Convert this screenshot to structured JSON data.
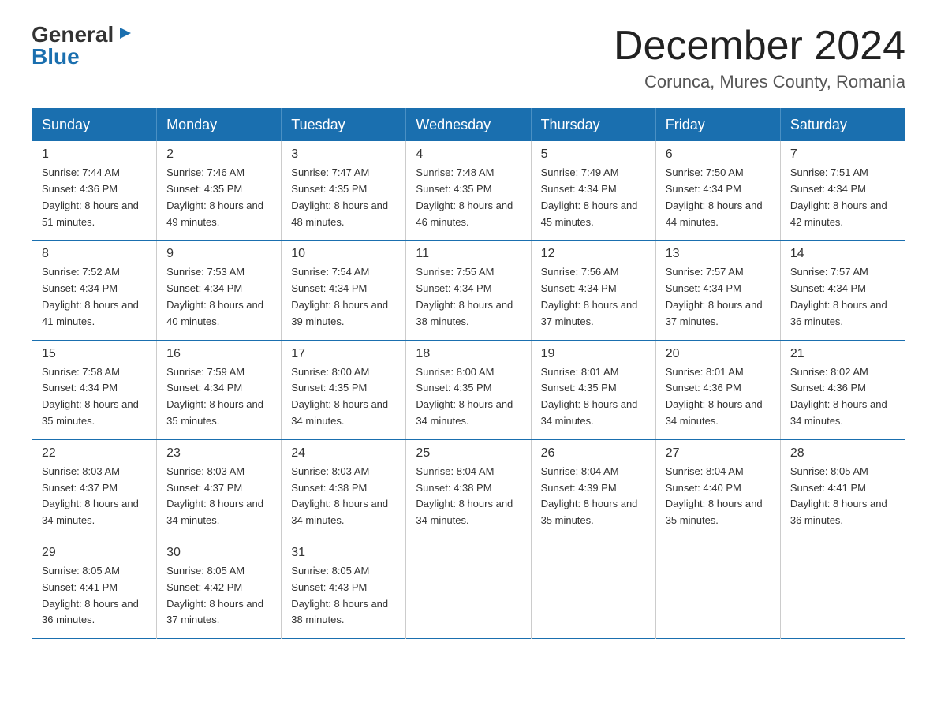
{
  "logo": {
    "general": "General",
    "blue": "Blue",
    "arrow": "▶"
  },
  "title": "December 2024",
  "subtitle": "Corunca, Mures County, Romania",
  "headers": [
    "Sunday",
    "Monday",
    "Tuesday",
    "Wednesday",
    "Thursday",
    "Friday",
    "Saturday"
  ],
  "weeks": [
    [
      {
        "day": "1",
        "sunrise": "7:44 AM",
        "sunset": "4:36 PM",
        "daylight": "8 hours and 51 minutes."
      },
      {
        "day": "2",
        "sunrise": "7:46 AM",
        "sunset": "4:35 PM",
        "daylight": "8 hours and 49 minutes."
      },
      {
        "day": "3",
        "sunrise": "7:47 AM",
        "sunset": "4:35 PM",
        "daylight": "8 hours and 48 minutes."
      },
      {
        "day": "4",
        "sunrise": "7:48 AM",
        "sunset": "4:35 PM",
        "daylight": "8 hours and 46 minutes."
      },
      {
        "day": "5",
        "sunrise": "7:49 AM",
        "sunset": "4:34 PM",
        "daylight": "8 hours and 45 minutes."
      },
      {
        "day": "6",
        "sunrise": "7:50 AM",
        "sunset": "4:34 PM",
        "daylight": "8 hours and 44 minutes."
      },
      {
        "day": "7",
        "sunrise": "7:51 AM",
        "sunset": "4:34 PM",
        "daylight": "8 hours and 42 minutes."
      }
    ],
    [
      {
        "day": "8",
        "sunrise": "7:52 AM",
        "sunset": "4:34 PM",
        "daylight": "8 hours and 41 minutes."
      },
      {
        "day": "9",
        "sunrise": "7:53 AM",
        "sunset": "4:34 PM",
        "daylight": "8 hours and 40 minutes."
      },
      {
        "day": "10",
        "sunrise": "7:54 AM",
        "sunset": "4:34 PM",
        "daylight": "8 hours and 39 minutes."
      },
      {
        "day": "11",
        "sunrise": "7:55 AM",
        "sunset": "4:34 PM",
        "daylight": "8 hours and 38 minutes."
      },
      {
        "day": "12",
        "sunrise": "7:56 AM",
        "sunset": "4:34 PM",
        "daylight": "8 hours and 37 minutes."
      },
      {
        "day": "13",
        "sunrise": "7:57 AM",
        "sunset": "4:34 PM",
        "daylight": "8 hours and 37 minutes."
      },
      {
        "day": "14",
        "sunrise": "7:57 AM",
        "sunset": "4:34 PM",
        "daylight": "8 hours and 36 minutes."
      }
    ],
    [
      {
        "day": "15",
        "sunrise": "7:58 AM",
        "sunset": "4:34 PM",
        "daylight": "8 hours and 35 minutes."
      },
      {
        "day": "16",
        "sunrise": "7:59 AM",
        "sunset": "4:34 PM",
        "daylight": "8 hours and 35 minutes."
      },
      {
        "day": "17",
        "sunrise": "8:00 AM",
        "sunset": "4:35 PM",
        "daylight": "8 hours and 34 minutes."
      },
      {
        "day": "18",
        "sunrise": "8:00 AM",
        "sunset": "4:35 PM",
        "daylight": "8 hours and 34 minutes."
      },
      {
        "day": "19",
        "sunrise": "8:01 AM",
        "sunset": "4:35 PM",
        "daylight": "8 hours and 34 minutes."
      },
      {
        "day": "20",
        "sunrise": "8:01 AM",
        "sunset": "4:36 PM",
        "daylight": "8 hours and 34 minutes."
      },
      {
        "day": "21",
        "sunrise": "8:02 AM",
        "sunset": "4:36 PM",
        "daylight": "8 hours and 34 minutes."
      }
    ],
    [
      {
        "day": "22",
        "sunrise": "8:03 AM",
        "sunset": "4:37 PM",
        "daylight": "8 hours and 34 minutes."
      },
      {
        "day": "23",
        "sunrise": "8:03 AM",
        "sunset": "4:37 PM",
        "daylight": "8 hours and 34 minutes."
      },
      {
        "day": "24",
        "sunrise": "8:03 AM",
        "sunset": "4:38 PM",
        "daylight": "8 hours and 34 minutes."
      },
      {
        "day": "25",
        "sunrise": "8:04 AM",
        "sunset": "4:38 PM",
        "daylight": "8 hours and 34 minutes."
      },
      {
        "day": "26",
        "sunrise": "8:04 AM",
        "sunset": "4:39 PM",
        "daylight": "8 hours and 35 minutes."
      },
      {
        "day": "27",
        "sunrise": "8:04 AM",
        "sunset": "4:40 PM",
        "daylight": "8 hours and 35 minutes."
      },
      {
        "day": "28",
        "sunrise": "8:05 AM",
        "sunset": "4:41 PM",
        "daylight": "8 hours and 36 minutes."
      }
    ],
    [
      {
        "day": "29",
        "sunrise": "8:05 AM",
        "sunset": "4:41 PM",
        "daylight": "8 hours and 36 minutes."
      },
      {
        "day": "30",
        "sunrise": "8:05 AM",
        "sunset": "4:42 PM",
        "daylight": "8 hours and 37 minutes."
      },
      {
        "day": "31",
        "sunrise": "8:05 AM",
        "sunset": "4:43 PM",
        "daylight": "8 hours and 38 minutes."
      },
      null,
      null,
      null,
      null
    ]
  ]
}
